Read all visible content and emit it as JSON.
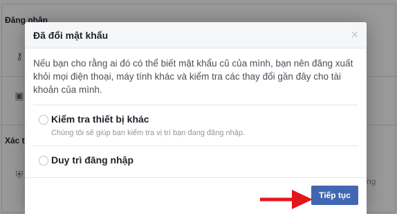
{
  "background": {
    "section_login": "Đăng nhập",
    "section_second": "Xác t",
    "right_text": "ng"
  },
  "dialog": {
    "title": "Đã đổi mật khẩu",
    "close_symbol": "×",
    "intro": "Nếu bạn cho rằng ai đó có thể biết mật khẩu cũ của mình, bạn nên đăng xuất khỏi mọi điện thoại, máy tính khác và kiểm tra các thay đổi gần đây cho tài khoản của mình.",
    "options": [
      {
        "title": "Kiểm tra thiết bị khác",
        "subtitle": "Chúng tôi sẽ giúp bạn kiểm tra vị trí bạn đang đăng nhập."
      },
      {
        "title": "Duy trì đăng nhập",
        "subtitle": ""
      }
    ],
    "continue_label": "Tiếp tục"
  },
  "colors": {
    "primary_button": "#4267b2",
    "arrow": "#e3161b"
  },
  "icons": [
    "key-icon",
    "id-card-icon",
    "shield-icon",
    "radio-icon",
    "close-icon",
    "arrow-icon"
  ]
}
